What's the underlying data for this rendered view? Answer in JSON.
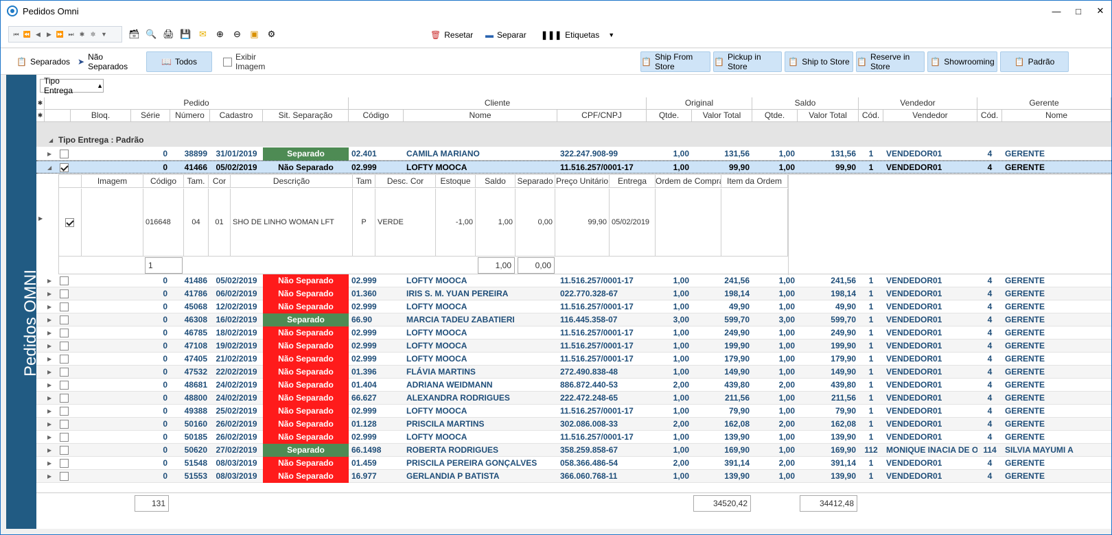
{
  "window": {
    "title": "Pedidos Omni"
  },
  "toolbar": {
    "reset": "Resetar",
    "separate": "Separar",
    "labels": "Etiquetas"
  },
  "filters": {
    "separated": "Separados",
    "not_separated": "Não Separados",
    "all": "Todos",
    "show_image": "Exibir Imagem"
  },
  "delivery_buttons": [
    "Ship From Store",
    "Pickup in Store",
    "Ship to Store",
    "Reserve in Store",
    "Showrooming",
    "Padrão"
  ],
  "sidebar": {
    "title": "Pedidos OMNI"
  },
  "group_box": {
    "label": "Tipo Entrega"
  },
  "bands": {
    "pedido": "Pedido",
    "cliente": "Cliente",
    "original": "Original",
    "saldo": "Saldo",
    "vendedor": "Vendedor",
    "gerente": "Gerente"
  },
  "columns": {
    "bloq": "Bloq.",
    "serie": "Série",
    "numero": "Número",
    "cadastro": "Cadastro",
    "sit": "Sit. Separação",
    "codigo": "Código",
    "nome": "Nome",
    "cpf": "CPF/CNPJ",
    "qtde": "Qtde.",
    "valor_total": "Valor Total",
    "saldo_qtde": "Qtde.",
    "saldo_valor": "Valor Total",
    "vend_cod": "Cód.",
    "vendedor": "Vendedor",
    "ger_cod": "Cód.",
    "ger_nome": "Nome"
  },
  "group_row": {
    "label": "Tipo Entrega : Padrão"
  },
  "rows": [
    {
      "serie": "0",
      "numero": "38899",
      "cadastro": "31/01/2019",
      "sit": "Separado",
      "cod": "02.401",
      "nome": "CAMILA MARIANO",
      "cpf": "322.247.908-99",
      "qtde": "1,00",
      "valor": "131,56",
      "sqtde": "1,00",
      "svalor": "131,56",
      "vcod": "1",
      "vend": "VENDEDOR01",
      "gcod": "4",
      "gnome": "GERENTE"
    },
    {
      "serie": "0",
      "numero": "41466",
      "cadastro": "05/02/2019",
      "sit": "Não Separado",
      "cod": "02.999",
      "nome": "LOFTY MOOCA",
      "cpf": "11.516.257/0001-17",
      "qtde": "1,00",
      "valor": "99,90",
      "sqtde": "1,00",
      "svalor": "99,90",
      "vcod": "1",
      "vend": "VENDEDOR01",
      "gcod": "4",
      "gnome": "GERENTE"
    },
    {
      "serie": "0",
      "numero": "41486",
      "cadastro": "05/02/2019",
      "sit": "Não Separado",
      "cod": "02.999",
      "nome": "LOFTY MOOCA",
      "cpf": "11.516.257/0001-17",
      "qtde": "1,00",
      "valor": "241,56",
      "sqtde": "1,00",
      "svalor": "241,56",
      "vcod": "1",
      "vend": "VENDEDOR01",
      "gcod": "4",
      "gnome": "GERENTE"
    },
    {
      "serie": "0",
      "numero": "41786",
      "cadastro": "06/02/2019",
      "sit": "Não Separado",
      "cod": "01.360",
      "nome": "IRIS S. M. YUAN PEREIRA",
      "cpf": "022.770.328-67",
      "qtde": "1,00",
      "valor": "198,14",
      "sqtde": "1,00",
      "svalor": "198,14",
      "vcod": "1",
      "vend": "VENDEDOR01",
      "gcod": "4",
      "gnome": "GERENTE"
    },
    {
      "serie": "0",
      "numero": "45068",
      "cadastro": "12/02/2019",
      "sit": "Não Separado",
      "cod": "02.999",
      "nome": "LOFTY MOOCA",
      "cpf": "11.516.257/0001-17",
      "qtde": "1,00",
      "valor": "49,90",
      "sqtde": "1,00",
      "svalor": "49,90",
      "vcod": "1",
      "vend": "VENDEDOR01",
      "gcod": "4",
      "gnome": "GERENTE"
    },
    {
      "serie": "0",
      "numero": "46308",
      "cadastro": "16/02/2019",
      "sit": "Separado",
      "cod": "66.90",
      "nome": "MARCIA TADEU ZABATIERI",
      "cpf": "116.445.358-07",
      "qtde": "3,00",
      "valor": "599,70",
      "sqtde": "3,00",
      "svalor": "599,70",
      "vcod": "1",
      "vend": "VENDEDOR01",
      "gcod": "4",
      "gnome": "GERENTE"
    },
    {
      "serie": "0",
      "numero": "46785",
      "cadastro": "18/02/2019",
      "sit": "Não Separado",
      "cod": "02.999",
      "nome": "LOFTY MOOCA",
      "cpf": "11.516.257/0001-17",
      "qtde": "1,00",
      "valor": "249,90",
      "sqtde": "1,00",
      "svalor": "249,90",
      "vcod": "1",
      "vend": "VENDEDOR01",
      "gcod": "4",
      "gnome": "GERENTE"
    },
    {
      "serie": "0",
      "numero": "47108",
      "cadastro": "19/02/2019",
      "sit": "Não Separado",
      "cod": "02.999",
      "nome": "LOFTY MOOCA",
      "cpf": "11.516.257/0001-17",
      "qtde": "1,00",
      "valor": "199,90",
      "sqtde": "1,00",
      "svalor": "199,90",
      "vcod": "1",
      "vend": "VENDEDOR01",
      "gcod": "4",
      "gnome": "GERENTE"
    },
    {
      "serie": "0",
      "numero": "47405",
      "cadastro": "21/02/2019",
      "sit": "Não Separado",
      "cod": "02.999",
      "nome": "LOFTY MOOCA",
      "cpf": "11.516.257/0001-17",
      "qtde": "1,00",
      "valor": "179,90",
      "sqtde": "1,00",
      "svalor": "179,90",
      "vcod": "1",
      "vend": "VENDEDOR01",
      "gcod": "4",
      "gnome": "GERENTE"
    },
    {
      "serie": "0",
      "numero": "47532",
      "cadastro": "22/02/2019",
      "sit": "Não Separado",
      "cod": "01.396",
      "nome": "FLÁVIA MARTINS",
      "cpf": "272.490.838-48",
      "qtde": "1,00",
      "valor": "149,90",
      "sqtde": "1,00",
      "svalor": "149,90",
      "vcod": "1",
      "vend": "VENDEDOR01",
      "gcod": "4",
      "gnome": "GERENTE"
    },
    {
      "serie": "0",
      "numero": "48681",
      "cadastro": "24/02/2019",
      "sit": "Não Separado",
      "cod": "01.404",
      "nome": "ADRIANA WEIDMANN",
      "cpf": "886.872.440-53",
      "qtde": "2,00",
      "valor": "439,80",
      "sqtde": "2,00",
      "svalor": "439,80",
      "vcod": "1",
      "vend": "VENDEDOR01",
      "gcod": "4",
      "gnome": "GERENTE"
    },
    {
      "serie": "0",
      "numero": "48800",
      "cadastro": "24/02/2019",
      "sit": "Não Separado",
      "cod": "66.627",
      "nome": "ALEXANDRA RODRIGUES",
      "cpf": "222.472.248-65",
      "qtde": "1,00",
      "valor": "211,56",
      "sqtde": "1,00",
      "svalor": "211,56",
      "vcod": "1",
      "vend": "VENDEDOR01",
      "gcod": "4",
      "gnome": "GERENTE"
    },
    {
      "serie": "0",
      "numero": "49388",
      "cadastro": "25/02/2019",
      "sit": "Não Separado",
      "cod": "02.999",
      "nome": "LOFTY MOOCA",
      "cpf": "11.516.257/0001-17",
      "qtde": "1,00",
      "valor": "79,90",
      "sqtde": "1,00",
      "svalor": "79,90",
      "vcod": "1",
      "vend": "VENDEDOR01",
      "gcod": "4",
      "gnome": "GERENTE"
    },
    {
      "serie": "0",
      "numero": "50160",
      "cadastro": "26/02/2019",
      "sit": "Não Separado",
      "cod": "01.128",
      "nome": "PRISCILA MARTINS",
      "cpf": "302.086.008-33",
      "qtde": "2,00",
      "valor": "162,08",
      "sqtde": "2,00",
      "svalor": "162,08",
      "vcod": "1",
      "vend": "VENDEDOR01",
      "gcod": "4",
      "gnome": "GERENTE"
    },
    {
      "serie": "0",
      "numero": "50185",
      "cadastro": "26/02/2019",
      "sit": "Não Separado",
      "cod": "02.999",
      "nome": "LOFTY MOOCA",
      "cpf": "11.516.257/0001-17",
      "qtde": "1,00",
      "valor": "139,90",
      "sqtde": "1,00",
      "svalor": "139,90",
      "vcod": "1",
      "vend": "VENDEDOR01",
      "gcod": "4",
      "gnome": "GERENTE"
    },
    {
      "serie": "0",
      "numero": "50620",
      "cadastro": "27/02/2019",
      "sit": "Separado",
      "cod": "66.1498",
      "nome": "ROBERTA RODRIGUES",
      "cpf": "358.259.858-67",
      "qtde": "1,00",
      "valor": "169,90",
      "sqtde": "1,00",
      "svalor": "169,90",
      "vcod": "112",
      "vend": "MONIQUE INACIA DE OLIV",
      "gcod": "114",
      "gnome": "SILVIA MAYUMI A"
    },
    {
      "serie": "0",
      "numero": "51548",
      "cadastro": "08/03/2019",
      "sit": "Não Separado",
      "cod": "01.459",
      "nome": "PRISCILA PEREIRA GONÇALVES",
      "cpf": "058.366.486-54",
      "qtde": "2,00",
      "valor": "391,14",
      "sqtde": "2,00",
      "svalor": "391,14",
      "vcod": "1",
      "vend": "VENDEDOR01",
      "gcod": "4",
      "gnome": "GERENTE"
    },
    {
      "serie": "0",
      "numero": "51553",
      "cadastro": "08/03/2019",
      "sit": "Não Separado",
      "cod": "16.977",
      "nome": "GERLANDIA P BATISTA",
      "cpf": "366.060.768-11",
      "qtde": "1,00",
      "valor": "139,90",
      "sqtde": "1,00",
      "svalor": "139,90",
      "vcod": "1",
      "vend": "VENDEDOR01",
      "gcod": "4",
      "gnome": "GERENTE"
    }
  ],
  "detail": {
    "headers": {
      "imagem": "Imagem",
      "codigo": "Código",
      "tam": "Tam.",
      "cor": "Cor",
      "descricao": "Descrição",
      "tam2": "Tam",
      "desc_cor": "Desc. Cor",
      "estoque": "Estoque",
      "saldo": "Saldo",
      "separado": "Separado",
      "preco": "Preço Unitário",
      "entrega": "Entrega",
      "ordem": "Ordem de Compra",
      "item": "Item da Ordem"
    },
    "item": {
      "codigo": "016648",
      "tam": "04",
      "cor": "01",
      "descricao": "SHO DE LINHO WOMAN LFT",
      "tam2": "P",
      "desc_cor": "VERDE",
      "estoque": "-1,00",
      "saldo": "1,00",
      "separado": "0,00",
      "preco": "99,90",
      "entrega": "05/02/2019"
    },
    "totals": {
      "count": "1",
      "saldo": "1,00",
      "separado": "0,00"
    }
  },
  "footer": {
    "count": "131",
    "total_original": "34520,42",
    "total_saldo": "34412,48"
  },
  "colors": {
    "separado": "#4e8b54",
    "nao_separado": "#ff1b1b",
    "selected_row": "#cde3f7",
    "sidebar": "#215b83"
  }
}
